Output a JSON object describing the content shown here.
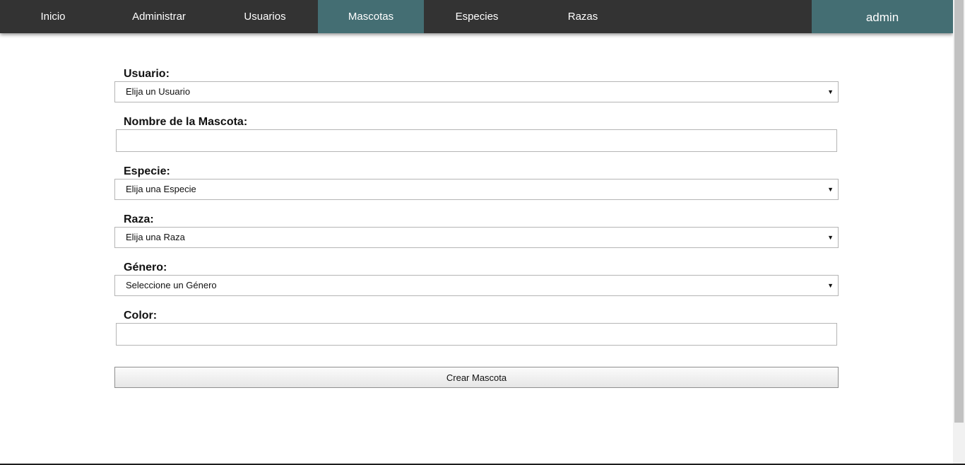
{
  "navbar": {
    "items": [
      {
        "label": "Inicio"
      },
      {
        "label": "Administrar"
      },
      {
        "label": "Usuarios"
      },
      {
        "label": "Mascotas"
      },
      {
        "label": "Especies"
      },
      {
        "label": "Razas"
      }
    ],
    "active_index": 3,
    "user_label": "admin",
    "colors": {
      "bar": "#333333",
      "active": "#446e73",
      "text": "#ffffff"
    }
  },
  "form": {
    "usuario": {
      "label": "Usuario:",
      "selected": "Elija un Usuario"
    },
    "nombre": {
      "label": "Nombre de la Mascota:",
      "value": ""
    },
    "especie": {
      "label": "Especie:",
      "selected": "Elija una Especie"
    },
    "raza": {
      "label": "Raza:",
      "selected": "Elija una Raza"
    },
    "genero": {
      "label": "Género:",
      "selected": "Seleccione un Género"
    },
    "color": {
      "label": "Color:",
      "value": ""
    },
    "submit_label": "Crear Mascota",
    "dropdown_arrow_icon": "triangle-down-icon"
  }
}
